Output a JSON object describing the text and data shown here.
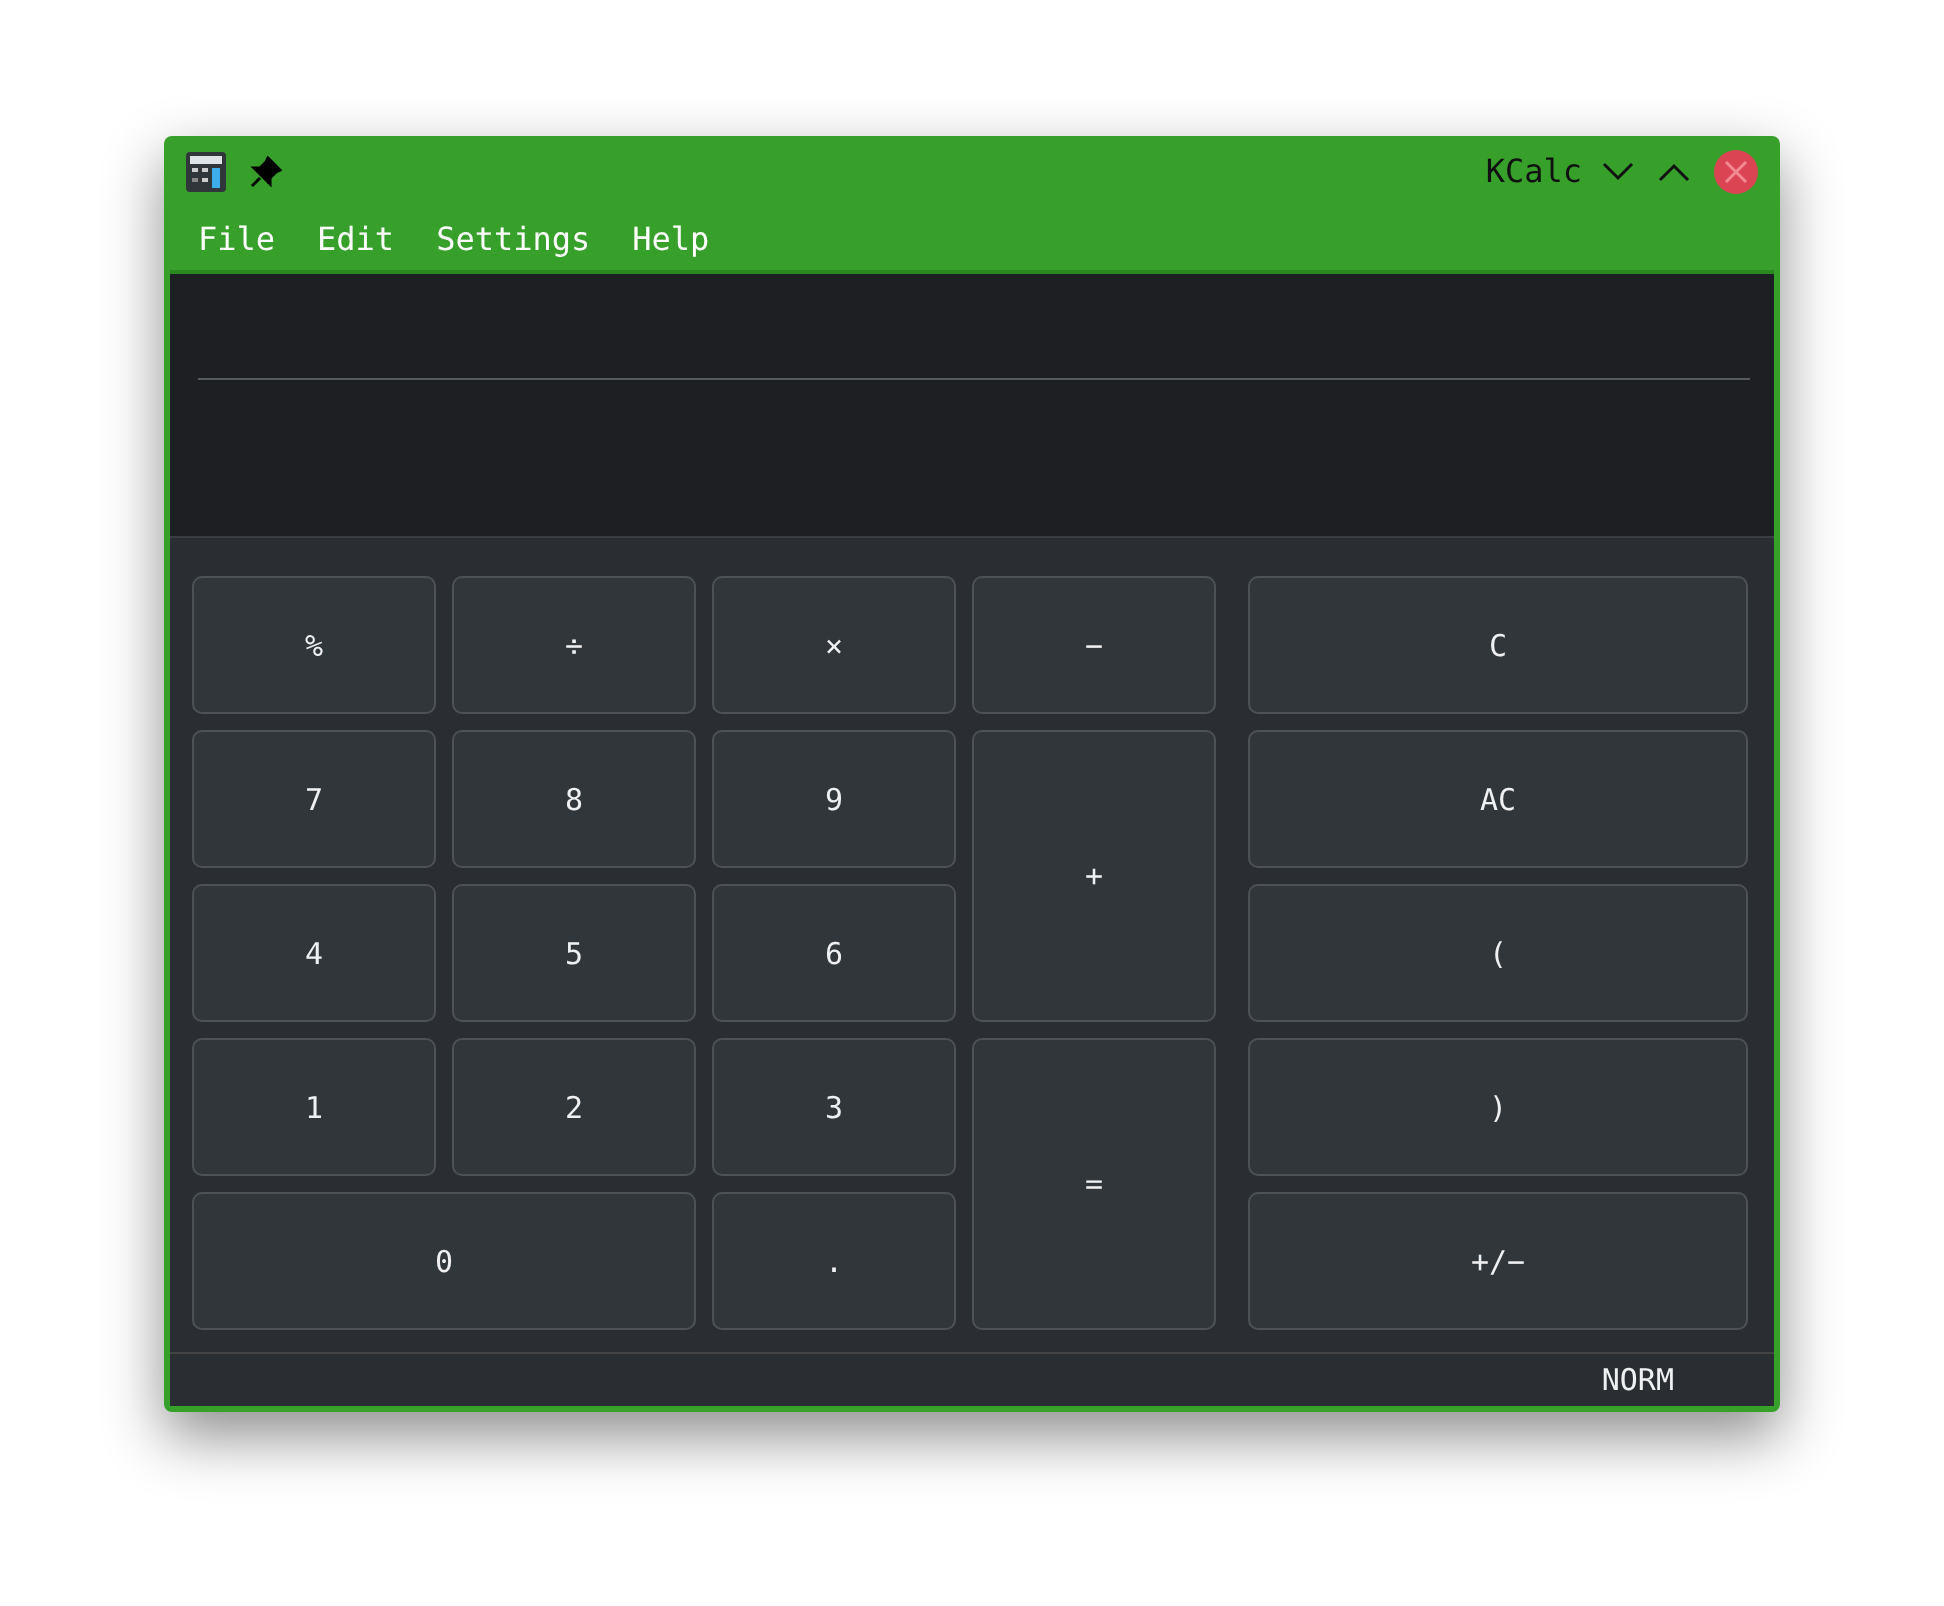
{
  "window": {
    "title": "KCalc"
  },
  "menu": [
    "File",
    "Edit",
    "Settings",
    "Help"
  ],
  "keypad": [
    "%",
    "÷",
    "×",
    "−",
    "7",
    "8",
    "9",
    "+",
    "4",
    "5",
    "6",
    "1",
    "2",
    "3",
    "=",
    "0",
    "."
  ],
  "functions": [
    "C",
    "AC",
    "(",
    ")",
    "+/−"
  ],
  "status_bar": {
    "mode": "NORM"
  }
}
